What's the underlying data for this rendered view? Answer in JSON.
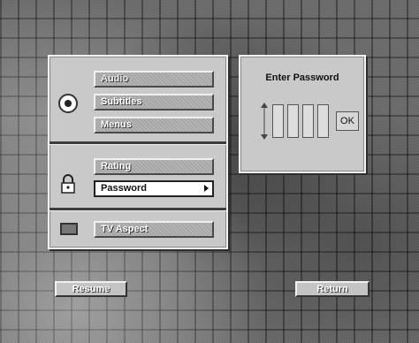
{
  "menu": {
    "disc_items": [
      {
        "label": "Audio",
        "enabled": false
      },
      {
        "label": "Subtitles",
        "enabled": true
      },
      {
        "label": "Menus",
        "enabled": true
      }
    ],
    "parental_items": [
      {
        "label": "Rating",
        "enabled": true
      },
      {
        "label": "Password",
        "selected": true
      }
    ],
    "display_items": [
      {
        "label": "TV Aspect",
        "enabled": true
      }
    ]
  },
  "password_dialog": {
    "title": "Enter Password",
    "ok_label": "OK"
  },
  "footer": {
    "resume_label": "Resume",
    "return_label": "Return"
  },
  "icons": {
    "disc": "disc-icon",
    "lock": "lock-icon",
    "tv": "tv-icon",
    "submenu": "chevron-right-icon",
    "spinner": "up-down-arrows-icon"
  }
}
